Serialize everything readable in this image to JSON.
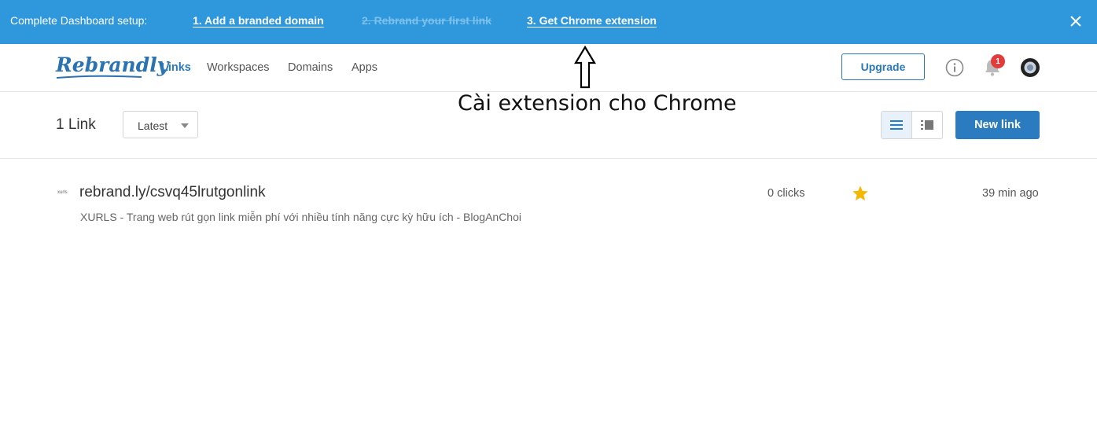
{
  "banner": {
    "label": "Complete Dashboard setup:",
    "steps": [
      {
        "label": "1. Add a branded domain",
        "state": "pending"
      },
      {
        "label": "2. Rebrand your first link",
        "state": "done"
      },
      {
        "label": "3. Get Chrome extension",
        "state": "pending"
      }
    ],
    "close_icon": "close-icon"
  },
  "nav": {
    "logo": "Rebrandly",
    "links": [
      "Links",
      "Workspaces",
      "Domains",
      "Apps"
    ],
    "active": "Links",
    "upgrade_label": "Upgrade",
    "notification_count": "1",
    "icons": [
      "info-icon",
      "bell-icon",
      "avatar"
    ]
  },
  "annotation": {
    "text": "Cài extension cho Chrome"
  },
  "toolbar": {
    "count": "1 Link",
    "sort_value": "Latest",
    "new_link_label": "New link",
    "view_modes": [
      "list-view-icon",
      "compact-view-icon"
    ]
  },
  "links": [
    {
      "favicon_text": "xurls",
      "url": "rebrand.ly/csvq45lrutgonlink",
      "title": "XURLS - Trang web rút gọn link miễn phí với nhiều tính năng cực kỳ hữu ích - BlogAnChoi",
      "clicks": "0 clicks",
      "starred": true,
      "time": "39 min ago"
    }
  ],
  "colors": {
    "banner": "#2f97dc",
    "primary": "#2a7bbf",
    "star": "#f5b800",
    "badge": "#e23b3b"
  }
}
